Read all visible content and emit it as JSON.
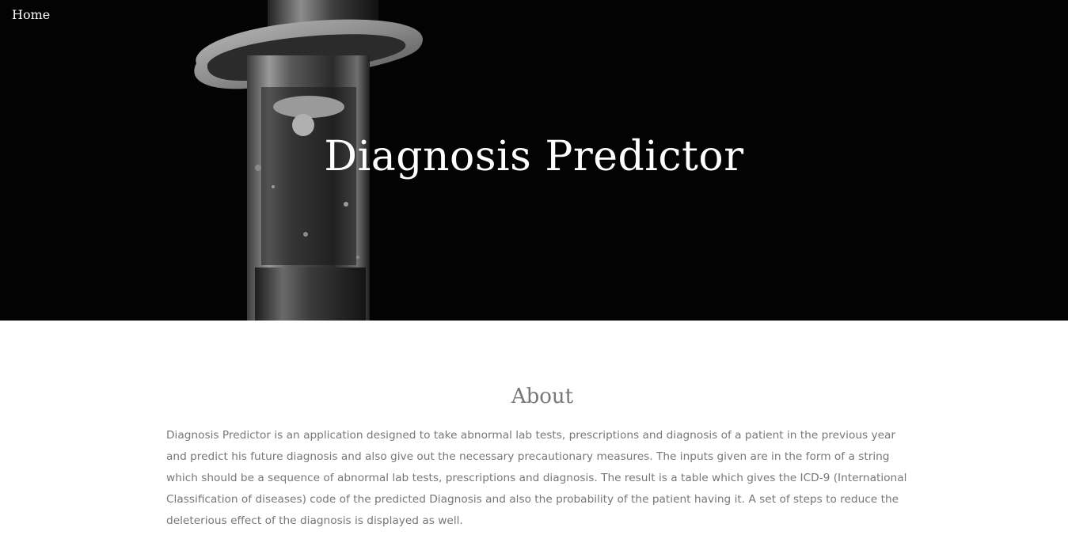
{
  "nav": {
    "home_label": "Home"
  },
  "hero": {
    "title": "Diagnosis Predictor",
    "background_image": "syringe-photo"
  },
  "about": {
    "heading": "About",
    "body": "Diagnosis Predictor is an application designed to take abnormal lab tests, prescriptions and diagnosis of a patient in the previous year and predict his future diagnosis and also give out the necessary precautionary measures. The inputs given are in the form of a string which should be a sequence of abnormal lab tests, prescriptions and diagnosis. The result is a table which gives the ICD-9 (International Classification of diseases) code of the predicted Diagnosis and also the probability of the patient having it. A set of steps to reduce the deleterious effect of the diagnosis is displayed as well."
  },
  "colors": {
    "hero_background": "#030303",
    "hero_text": "#ffffff",
    "body_text": "#777777",
    "page_background": "#ffffff"
  }
}
